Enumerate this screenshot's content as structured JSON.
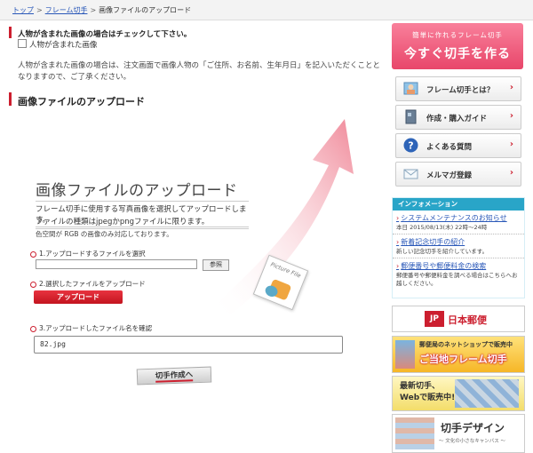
{
  "breadcrumb": {
    "items": [
      "トップ",
      "フレーム切手",
      "画像ファイルのアップロード"
    ],
    "separator": ">"
  },
  "person_section": {
    "heading": "人物が含まれた画像の場合はチェックして下さい。",
    "checkbox_label": "人物が含まれた画像",
    "note": "人物が含まれた画像の場合は、注文画面で画像人物の「ご住所、お名前、生年月日」を記入いただくこととなりますので、ご了承ください。"
  },
  "section_title": "画像ファイルのアップロード",
  "upload": {
    "title": "画像ファイルのアップロード",
    "desc1": "フレーム切手に使用する写真画像を選択してアップロードします。",
    "desc2": "ファイルの種類はjpegかpngファイルに限ります。",
    "desc3": "色空間が RGB の画像のみ対応しております。",
    "step1": "1.アップロードするファイルを選択",
    "browse_label": "参照",
    "step2": "2.選択したファイルをアップロード",
    "upload_button": "アップロード",
    "step3": "3.アップロードしたファイル名を確認",
    "filename": "82.jpg",
    "create_button": "切手作成へ",
    "picture_label": "Picture File"
  },
  "sidebar": {
    "promo_sub": "簡単に作れるフレーム切手",
    "promo_main": "今すぐ切手を作る",
    "nav": [
      {
        "label": "フレーム切手とは？",
        "icon": "photo-icon"
      },
      {
        "label": "作成・購入ガイド",
        "icon": "guide-book-icon"
      },
      {
        "label": "よくある質問",
        "icon": "question-icon"
      },
      {
        "label": "メルマガ登録",
        "icon": "mail-icon"
      }
    ],
    "info": {
      "heading": "インフォメーション",
      "items": [
        {
          "link": "システムメンテナンスのお知らせ",
          "sub": "本日 2015/08/13(木) 22時〜24時"
        },
        {
          "link": "新着記念切手の紹介",
          "sub": "新しい記念切手を紹介しています。"
        },
        {
          "link": "郵便番号や郵便料金の検索",
          "sub": "郵便番号や郵便料金を調べる場合はこちらへお越しください。"
        }
      ]
    },
    "banners": {
      "japanpost_logo": "JP",
      "japanpost": "日本郵便",
      "shop_line1": "郵便局のネットショップで販売中",
      "shop_line2": "ご当地フレーム切手",
      "latest_line1": "最新切手、",
      "latest_line2": "Webで販売中!",
      "design_title": "切手デザイン",
      "design_sub": "〜 文化の小さなキャンバス 〜"
    }
  },
  "colors": {
    "accent_red": "#cc1f2f",
    "link_blue": "#2a58b8",
    "info_blue": "#29a5c8",
    "promo_pink": "#e8466a"
  }
}
